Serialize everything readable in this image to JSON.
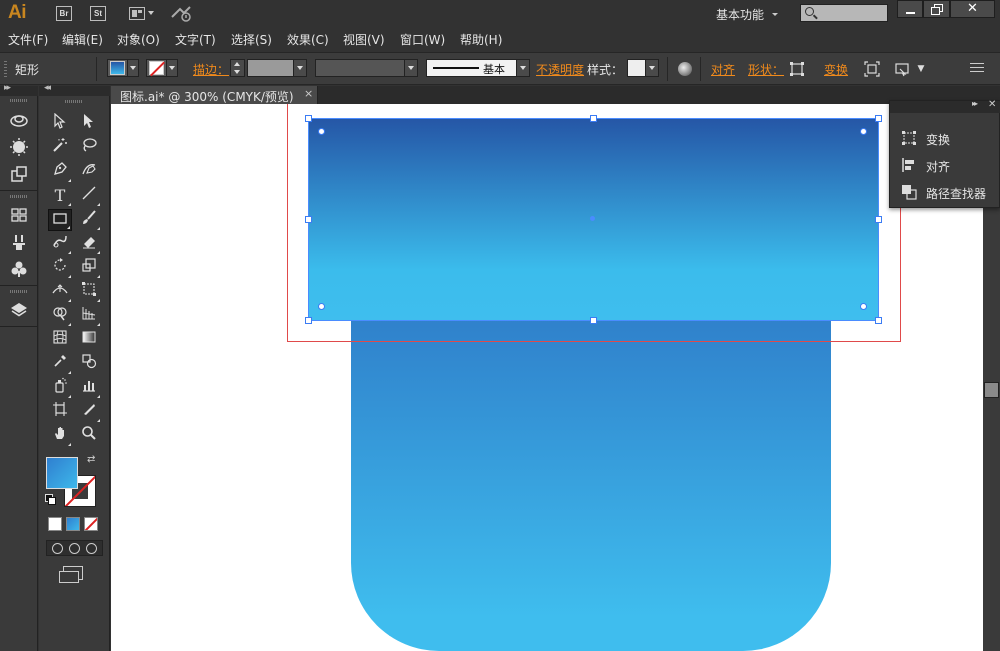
{
  "app": {
    "logo": "Ai"
  },
  "titlebar": {
    "bridge_label": "Br",
    "stock_label": "St",
    "workspace": "基本功能",
    "close_symbol": "✕"
  },
  "menu": [
    "文件(F)",
    "编辑(E)",
    "对象(O)",
    "文字(T)",
    "选择(S)",
    "效果(C)",
    "视图(V)",
    "窗口(W)",
    "帮助(H)"
  ],
  "control": {
    "selection_type": "矩形",
    "stroke_label": "描边：",
    "stroke_profile": "基本",
    "opacity_label": "不透明度",
    "style_label": "样式：",
    "align_label": "对齐",
    "shape_label": "形状：",
    "transform_label": "变换"
  },
  "document": {
    "tab_title": "图标.ai* @ 300% (CMYK/预览)",
    "tab_close": "×"
  },
  "float_panel": {
    "items": [
      {
        "label": "变换",
        "icon": "transform-icon"
      },
      {
        "label": "对齐",
        "icon": "align-icon"
      },
      {
        "label": "路径查找器",
        "icon": "pathfinder-icon"
      }
    ]
  },
  "colors": {
    "fill_gradient_top": "#2556a6",
    "fill_gradient_bottom": "#3fbeee",
    "selection": "#3b7cf4",
    "annotation_box": "#e04a4a",
    "accent_orange": "#f08a1c"
  }
}
